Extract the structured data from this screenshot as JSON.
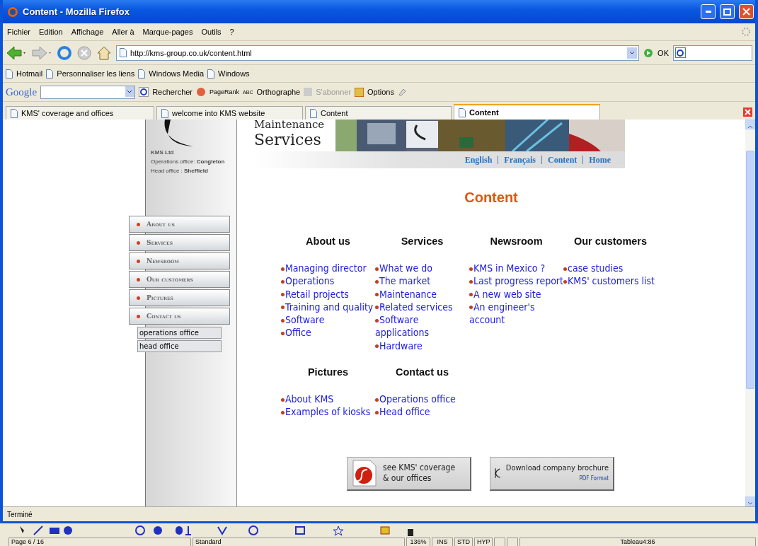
{
  "window": {
    "title": "Content - Mozilla Firefox"
  },
  "menu": [
    "Fichier",
    "Edition",
    "Affichage",
    "Aller à",
    "Marque-pages",
    "Outils",
    "?"
  ],
  "address": {
    "url": "http://kms-group.co.uk/content.html",
    "go": "OK"
  },
  "bookmarks": [
    "Hotmail",
    "Personnaliser les liens",
    "Windows Media",
    "Windows"
  ],
  "google_bar": {
    "brand": "Google",
    "search": "Rechercher",
    "pagerank": "PageRank",
    "spell_badge": "ABC",
    "spell": "Orthographe",
    "subscribe": "S'abonner",
    "options": "Options"
  },
  "tabs": [
    {
      "label": "KMS' coverage and offices",
      "selected": false
    },
    {
      "label": "welcome into KMS website",
      "selected": false
    },
    {
      "label": "Content",
      "selected": false
    },
    {
      "label": "Content",
      "selected": true
    }
  ],
  "site": {
    "logo": [
      "Maintenance",
      "Services"
    ],
    "lang_links": [
      "English",
      "Français",
      "Content",
      "Home"
    ],
    "company": {
      "name": "KMS Ltd",
      "lines": [
        {
          "label": "Operations office:",
          "value": "Congleton"
        },
        {
          "label": "Head office :",
          "value": "Sheffield"
        }
      ]
    },
    "nav": [
      "About us",
      "Services",
      "Newsroom",
      "Our customers",
      "Pictures",
      "Contact us"
    ],
    "subnav": [
      "operations office",
      "head office"
    ],
    "heading": "Content",
    "sections": [
      {
        "title": "About us",
        "links": [
          "Managing director",
          "Operations",
          "Retail projects",
          "Training and quality",
          "Software",
          "Office"
        ]
      },
      {
        "title": "Services",
        "links": [
          "What we do",
          "The market",
          "Maintenance",
          "Related services",
          "Software applications",
          "Hardware"
        ]
      },
      {
        "title": "Newsroom",
        "links": [
          "KMS in Mexico ?",
          "Last progress report",
          "A new web site",
          "An engineer's account"
        ]
      },
      {
        "title": "Our customers",
        "links": [
          "case studies",
          "KMS' customers list"
        ]
      },
      {
        "title": "Pictures",
        "links": [
          "About KMS",
          "Examples of kiosks"
        ]
      },
      {
        "title": "Contact us",
        "links": [
          "Operations office",
          "Head office"
        ]
      }
    ],
    "buttons": [
      {
        "kind": "flash",
        "lines": [
          "see KMS' coverage",
          "& our offices"
        ]
      },
      {
        "kind": "pdf",
        "lines": [
          "Download company brochure"
        ],
        "note": "PDF Format"
      }
    ]
  },
  "status": "Terminé",
  "office_status": [
    "Page 6 / 16",
    "Standard",
    "136%",
    "INS",
    "STD",
    "HYP",
    "Tableau4:86"
  ]
}
